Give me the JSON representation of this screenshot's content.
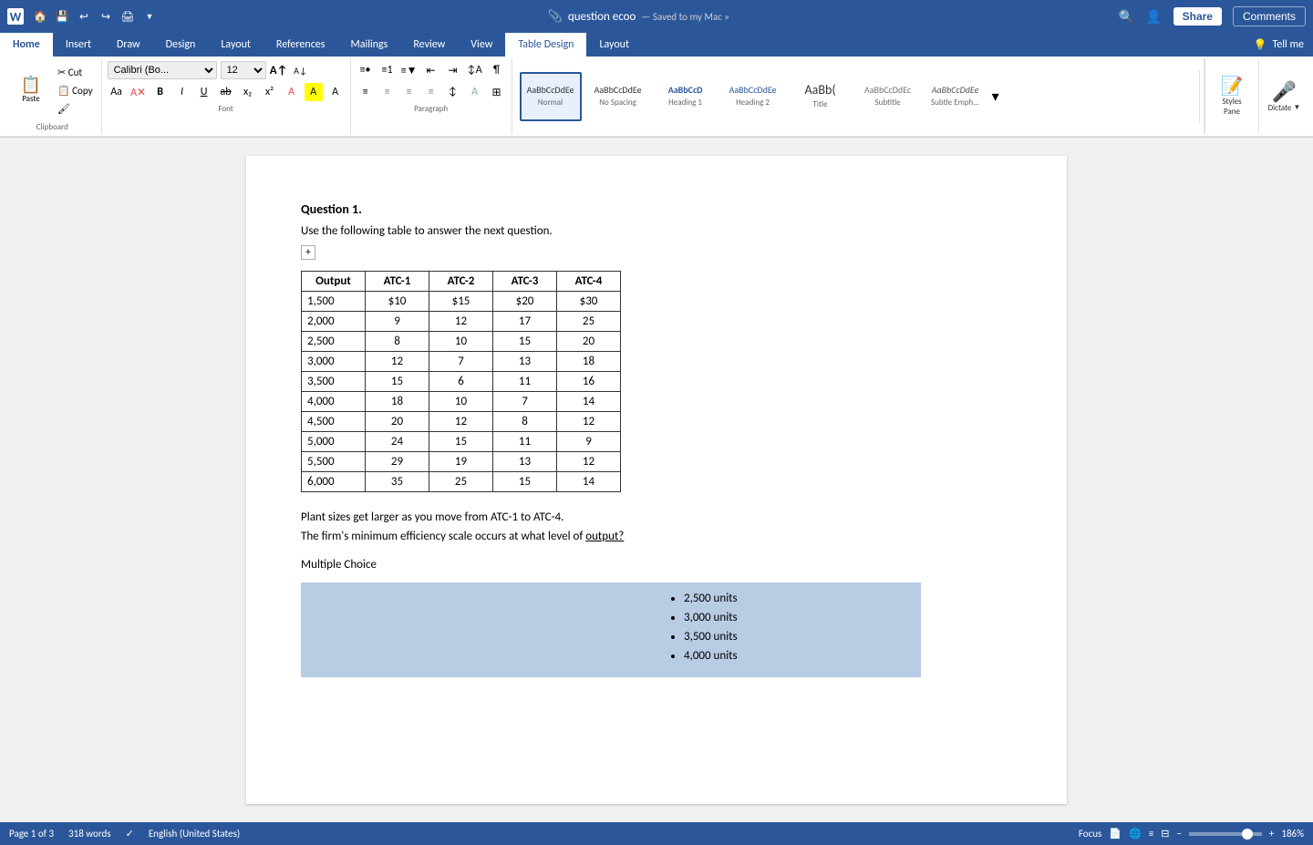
{
  "titlebar": {
    "logo": "W",
    "quick_access": [
      "💾",
      "↩",
      "↪",
      "🖨",
      "▼"
    ],
    "doc_name": "question ecoo",
    "saved_status": "— Saved to my Mac »",
    "search_icon": "🔍",
    "profile_icon": "👤",
    "share_label": "Share",
    "comments_label": "Comments"
  },
  "ribbon": {
    "tabs": [
      "Home",
      "Insert",
      "Draw",
      "Design",
      "Layout",
      "References",
      "Mailings",
      "Review",
      "View",
      "Table Design",
      "Layout"
    ],
    "active_tab": "Home",
    "tell_me": "Tell me",
    "font": "Calibri (Bo...",
    "font_size": "12",
    "styles": [
      {
        "label": "Normal",
        "preview": "AaBbCcDdEe",
        "selected": true
      },
      {
        "label": "No Spacing",
        "preview": "AaBbCcDdEe"
      },
      {
        "label": "Heading 1",
        "preview": "AaBbCcD"
      },
      {
        "label": "Heading 2",
        "preview": "AaBbCcDdEe"
      },
      {
        "label": "Title",
        "preview": "AaBb("
      },
      {
        "label": "Subtitle",
        "preview": "AaBbCcDdEc"
      },
      {
        "label": "Subtle Emph...",
        "preview": "AaBbCcDdEe"
      }
    ],
    "styles_pane_label": "Styles\nPane",
    "dictate_label": "Dictate"
  },
  "document": {
    "question_heading": "Question 1.",
    "intro_text": "Use the following table to answer the next question.",
    "table": {
      "headers": [
        "Output",
        "ATC-1",
        "ATC-2",
        "ATC-3",
        "ATC-4"
      ],
      "rows": [
        [
          "1,500",
          "$10",
          "$15",
          "$20",
          "$30"
        ],
        [
          "2,000",
          "9",
          "12",
          "17",
          "25"
        ],
        [
          "2,500",
          "8",
          "10",
          "15",
          "20"
        ],
        [
          "3,000",
          "12",
          "7",
          "13",
          "18"
        ],
        [
          "3,500",
          "15",
          "6",
          "11",
          "16"
        ],
        [
          "4,000",
          "18",
          "10",
          "7",
          "14"
        ],
        [
          "4,500",
          "20",
          "12",
          "8",
          "12"
        ],
        [
          "5,000",
          "24",
          "15",
          "11",
          "9"
        ],
        [
          "5,500",
          "29",
          "19",
          "13",
          "12"
        ],
        [
          "6,000",
          "35",
          "25",
          "15",
          "14"
        ]
      ]
    },
    "plant_text": "Plant sizes get larger as you move from ATC-1 to ATC-4.",
    "question_text": "The firm's minimum efficiency scale occurs at what level of ",
    "question_link": "output?",
    "multiple_choice_label": "Multiple Choice",
    "choices": [
      "2,500 units",
      "3,000 units",
      "3,500 units",
      "4,000 units"
    ]
  },
  "statusbar": {
    "page_info": "Page 1 of 3",
    "words": "318 words",
    "proofing_icon": "✓",
    "language": "English (United States)",
    "focus": "Focus",
    "view_icons": [
      "📄",
      "📋",
      "≡",
      "⊟"
    ],
    "zoom_out": "-",
    "zoom_in": "+",
    "zoom_level": "186%"
  }
}
